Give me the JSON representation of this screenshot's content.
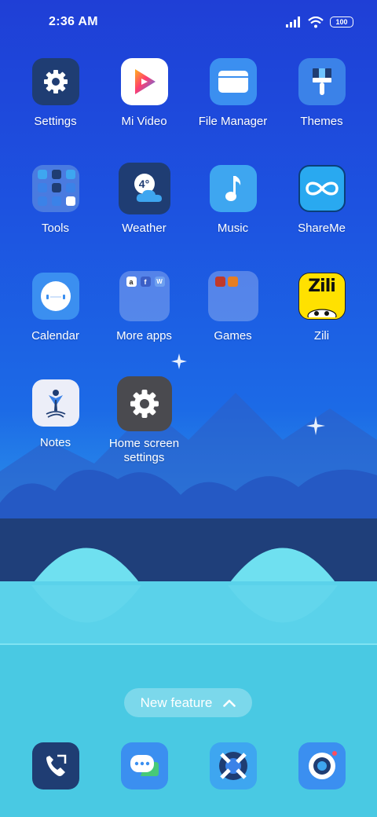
{
  "status_bar": {
    "time": "2:36 AM",
    "battery": "100",
    "icons": [
      "signal-icon",
      "wifi-icon",
      "battery-icon"
    ]
  },
  "apps": {
    "settings": "Settings",
    "mi_video": "Mi Video",
    "file_manager": "File Manager",
    "themes": "Themes",
    "tools": "Tools",
    "weather": "Weather",
    "weather_temp": "4°",
    "music": "Music",
    "shareme": "ShareMe",
    "calendar": "Calendar",
    "more_apps": "More apps",
    "games": "Games",
    "zili": "Zili",
    "zili_logo": "Zili",
    "notes": "Notes",
    "home_screen_settings_line1": "Home screen",
    "home_screen_settings_line2": "settings"
  },
  "new_feature": {
    "label": "New feature",
    "icon": "chevron-up-icon"
  },
  "dock": [
    "phone-icon",
    "messages-icon",
    "browser-icon",
    "camera-icon"
  ],
  "colors": {
    "icon_dark": "#1f3d73",
    "icon_blue": "#3b82e8",
    "icon_light_blue": "#3ea6f0",
    "accent_yellow": "#ffe100"
  }
}
